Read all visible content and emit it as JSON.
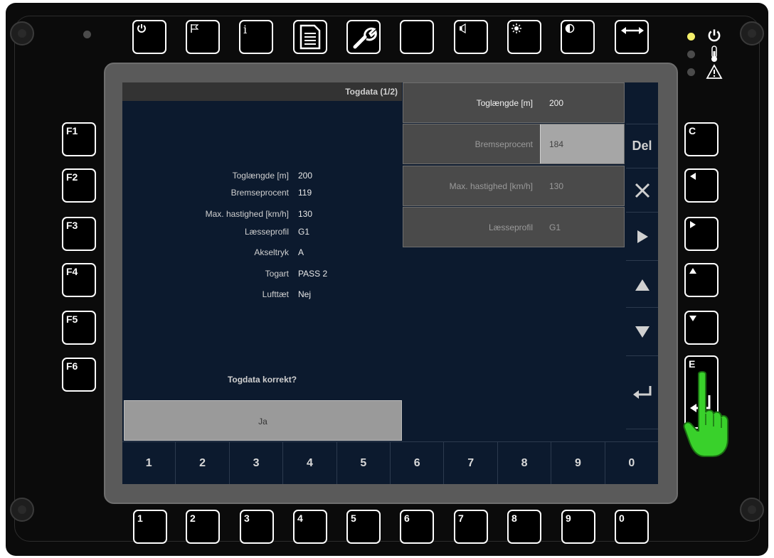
{
  "top_keys": [
    {
      "id": "power",
      "icon": "power-icon"
    },
    {
      "id": "flag",
      "icon": "flag-icon"
    },
    {
      "id": "info",
      "icon": "info-icon",
      "label": "i"
    },
    {
      "id": "document",
      "icon": "document-icon"
    },
    {
      "id": "tools",
      "icon": "wrench-icon"
    },
    {
      "id": "blank",
      "icon": ""
    },
    {
      "id": "volume",
      "icon": "speaker-icon"
    },
    {
      "id": "brightness",
      "icon": "brightness-icon"
    },
    {
      "id": "contrast",
      "icon": "contrast-icon"
    },
    {
      "id": "swap",
      "icon": "double-arrow-icon"
    }
  ],
  "left_keys": [
    "F1",
    "F2",
    "F3",
    "F4",
    "F5",
    "F6"
  ],
  "right_keys": {
    "c": "C",
    "e": "E"
  },
  "bottom_keys": [
    "1",
    "2",
    "3",
    "4",
    "5",
    "6",
    "7",
    "8",
    "9",
    "0"
  ],
  "status_leds": [
    {
      "name": "power",
      "color": "#f3ef6a",
      "icon": "power-icon"
    },
    {
      "name": "temperature",
      "color": "#4b4b4b",
      "icon": "thermometer-icon"
    },
    {
      "name": "warning",
      "color": "#4b4b4b",
      "icon": "warning-icon"
    }
  ],
  "screen": {
    "title": "Togdata (1/2)",
    "info": [
      {
        "label": "Toglængde [m]",
        "value": "200"
      },
      {
        "label": "Bremseprocent",
        "value": "119"
      },
      {
        "label": "Max. hastighed [km/h]",
        "value": "130"
      },
      {
        "label": "Læsseprofil",
        "value": "G1"
      },
      {
        "label": "Akseltryk",
        "value": "A"
      },
      {
        "label": "Togart",
        "value": "PASS 2"
      },
      {
        "label": "Lufttæt",
        "value": "Nej"
      }
    ],
    "question": "Togdata korrekt?",
    "confirm_label": "Ja",
    "edit_rows": [
      {
        "label": "Toglængde  [m]",
        "value": "200",
        "state": "active"
      },
      {
        "label": "Bremseprocent",
        "value": "184",
        "state": "editing"
      },
      {
        "label": "Max. hastighed  [km/h]",
        "value": "130",
        "state": "dim"
      },
      {
        "label": "Læsseprofil",
        "value": "G1",
        "state": "dim"
      }
    ],
    "side_buttons": {
      "delete": "Del"
    },
    "numpad": [
      "1",
      "2",
      "3",
      "4",
      "5",
      "6",
      "7",
      "8",
      "9",
      "0"
    ]
  },
  "colors": {
    "screen_bg": "#0c1a2e",
    "led_on": "#f3ef6a",
    "finger": "#39d12b"
  }
}
